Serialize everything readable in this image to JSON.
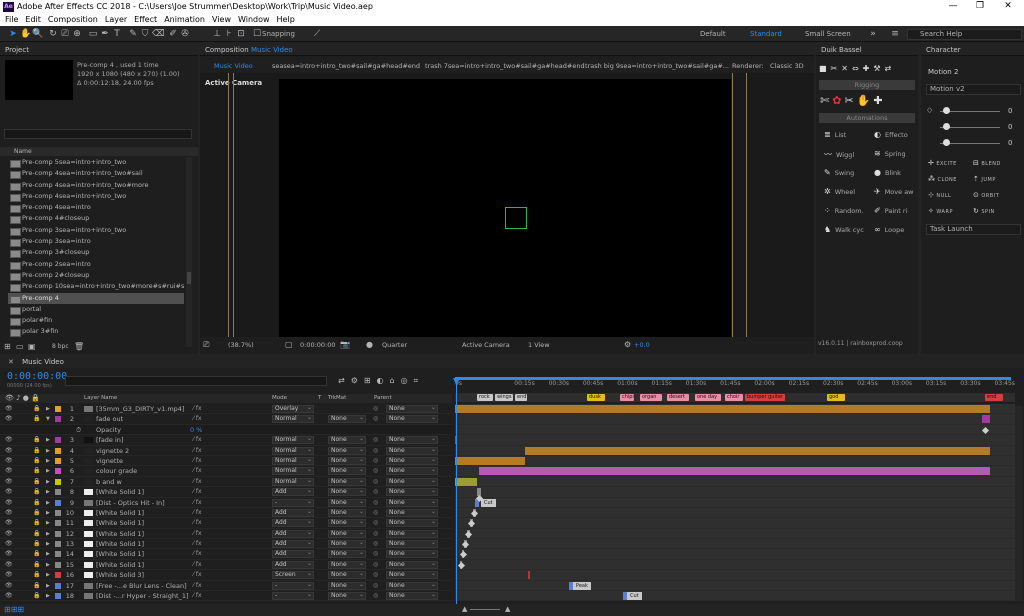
{
  "window": {
    "title": "Adobe After Effects CC 2018 - C:\\Users\\Joe Strummer\\Desktop\\Work\\Trip\\Music Video.aep",
    "logo": "Ae",
    "controls": [
      "—",
      "❐",
      "✕"
    ]
  },
  "menu": [
    "File",
    "Edit",
    "Composition",
    "Layer",
    "Effect",
    "Animation",
    "View",
    "Window",
    "Help"
  ],
  "toolbar": {
    "snapping": "Snapping",
    "workspaces": [
      "Default",
      "Standard",
      "Small Screen"
    ],
    "active_workspace": "Standard",
    "search_placeholder": "Search Help"
  },
  "project": {
    "title": "Project",
    "selected_name": "Pre-comp 4",
    "used": ", used 1 time",
    "dims": "1920 x 1080  (480 x 270) (1.00)",
    "duration": "Δ 0:00:12:18, 24.00 fps",
    "col_name": "Name",
    "items": [
      "Pre-comp 5sea=intro+intro_two",
      "Pre-comp 4sea=intro+intro_two#sail",
      "Pre-comp 4sea=intro+intro_two#more",
      "Pre-comp 4sea=intro+intro_two",
      "Pre-comp 4sea=intro",
      "Pre-comp 4#closeup",
      "Pre-comp 3sea=intro+intro_two",
      "Pre-comp 3sea=intro",
      "Pre-comp 3#closeup",
      "Pre-comp 2sea=intro",
      "Pre-comp 2#closeup",
      "Pre-comp 10sea=intro+intro_two#more#s#rui#slide#m",
      "Pre-comp 4",
      "portal",
      "polar#fin",
      "polar 3#fin"
    ],
    "selected_index": 12,
    "bpc": "8 bpc"
  },
  "composition": {
    "title": "Composition",
    "comp_name": "Music Video",
    "tabs": [
      "Music Video",
      "seasea=intro+intro_two#sail#ga#head#end",
      "trash 7sea=intro+intro_two#sail#ga#head#end",
      "trash big 9sea=intro+intro_two#sail#ga#..."
    ],
    "renderer_label": "Renderer:",
    "renderer": "Classic 3D",
    "camera_label": "Active Camera",
    "zoom": "(38.7%)",
    "timecode": "0:00:00:00",
    "resolution": "Quarter",
    "camera": "Active Camera",
    "view": "1 View",
    "exposure": "+0.0"
  },
  "duik": {
    "title": "Duik Bassel",
    "rigging": "Rigging",
    "automations": "Automations",
    "buttons": [
      {
        "label": "List",
        "icon": "≣"
      },
      {
        "label": "Effecto",
        "icon": "◐"
      },
      {
        "label": "Wiggl",
        "icon": "〰"
      },
      {
        "label": "Spring",
        "icon": "≋"
      },
      {
        "label": "Swing",
        "icon": "✎"
      },
      {
        "label": "Blink",
        "icon": "●"
      },
      {
        "label": "Wheel",
        "icon": "✲"
      },
      {
        "label": "Move aw",
        "icon": "✈"
      },
      {
        "label": "Random.",
        "icon": "⁘"
      },
      {
        "label": "Paint ri",
        "icon": "✐"
      },
      {
        "label": "Walk cyc",
        "icon": "♞"
      },
      {
        "label": "Loope",
        "icon": "∞"
      }
    ],
    "version": "v16.0.11 | rainboxprod.coop"
  },
  "character": {
    "title": "Character",
    "motion_title": "Motion 2",
    "preset": "Motion v2",
    "slider_values": [
      "0",
      "0",
      "0"
    ],
    "buttons": [
      {
        "label": "EXCITE",
        "icon": "✛"
      },
      {
        "label": "BLEND",
        "icon": "⊟"
      },
      {
        "label": "CLONE",
        "icon": "⁂"
      },
      {
        "label": "JUMP",
        "icon": "⇡"
      },
      {
        "label": "NULL",
        "icon": "⊹"
      },
      {
        "label": "ORBIT",
        "icon": "⊙"
      },
      {
        "label": "WARP",
        "icon": "✧"
      },
      {
        "label": "SPIN",
        "icon": "↻"
      }
    ],
    "task": "Task Launch"
  },
  "timeline": {
    "tab": "Music Video",
    "timecode": "0:00:00:00",
    "fps": "00000 (24.00 fps)",
    "headers": {
      "layer_name": "Layer Name",
      "mode": "Mode",
      "t": "T",
      "trkmat": "TrkMat",
      "parent": "Parent"
    },
    "ruler": [
      "0s",
      "00:15s",
      "00:30s",
      "00:45s",
      "01:00s",
      "01:15s",
      "01:30s",
      "01:45s",
      "02:00s",
      "02:15s",
      "02:30s",
      "02:45s",
      "03:00s",
      "03:15s",
      "03:30s",
      "03:45s",
      "04:0"
    ],
    "markers": [
      {
        "label": "rock",
        "color": "#c8c8c8"
      },
      {
        "label": "wings",
        "color": "#c8c8c8"
      },
      {
        "label": "end",
        "color": "#c8c8c8"
      },
      {
        "label": "dusk",
        "color": "#e0c020"
      },
      {
        "label": "chips",
        "color": "#e88fa8"
      },
      {
        "label": "organ",
        "color": "#e88fa8"
      },
      {
        "label": "desert",
        "color": "#e88fa8"
      },
      {
        "label": "one day",
        "color": "#e88fa8"
      },
      {
        "label": "choir",
        "color": "#e88fa8"
      },
      {
        "label": "bumper guitar",
        "color": "#d04040"
      },
      {
        "label": "god",
        "color": "#e0c020"
      },
      {
        "label": "end",
        "color": "#d04040"
      }
    ],
    "opacity_label": "Opacity",
    "opacity_value": "0 %",
    "cut_label": "Cut",
    "peak_label": "Peak",
    "layers": [
      {
        "num": "1",
        "name": "[35mm_G3_DIRTY_v1.mp4]",
        "label": "#e0a020",
        "thumb": "#777",
        "mode": "Overlay",
        "trk": "",
        "parent": "None"
      },
      {
        "num": "2",
        "name": "fade out",
        "label": "#a33aa3",
        "thumb": "#222",
        "mode": "Normal",
        "trk": "None",
        "parent": "None"
      },
      {
        "num": "3",
        "name": "[fade in]",
        "label": "#a33aa3",
        "thumb": "#111",
        "mode": "Normal",
        "trk": "None",
        "parent": "None"
      },
      {
        "num": "4",
        "name": "vignette 2",
        "label": "#e0a020",
        "thumb": "#222",
        "mode": "Normal",
        "trk": "None",
        "parent": "None"
      },
      {
        "num": "5",
        "name": "vignette",
        "label": "#e0a020",
        "thumb": "#222",
        "mode": "Normal",
        "trk": "None",
        "parent": "None"
      },
      {
        "num": "6",
        "name": "colour grade",
        "label": "#c64bc6",
        "thumb": "#222",
        "mode": "Normal",
        "trk": "None",
        "parent": "None"
      },
      {
        "num": "7",
        "name": "b and w",
        "label": "#c8c800",
        "thumb": "#222",
        "mode": "Normal",
        "trk": "None",
        "parent": "None"
      },
      {
        "num": "8",
        "name": "[White Solid 1]",
        "label": "#888",
        "thumb": "#eee",
        "mode": "Add",
        "trk": "None",
        "parent": "None"
      },
      {
        "num": "9",
        "name": "[Dist - Optics Hit - In]",
        "label": "#5b7fd0",
        "thumb": "#777",
        "mode": "-",
        "trk": "None",
        "parent": "None"
      },
      {
        "num": "10",
        "name": "[White Solid 1]",
        "label": "#888",
        "thumb": "#eee",
        "mode": "Add",
        "trk": "None",
        "parent": "None"
      },
      {
        "num": "11",
        "name": "[White Solid 1]",
        "label": "#888",
        "thumb": "#eee",
        "mode": "Add",
        "trk": "None",
        "parent": "None"
      },
      {
        "num": "12",
        "name": "[White Solid 1]",
        "label": "#888",
        "thumb": "#eee",
        "mode": "Add",
        "trk": "None",
        "parent": "None"
      },
      {
        "num": "13",
        "name": "[White Solid 1]",
        "label": "#888",
        "thumb": "#eee",
        "mode": "Add",
        "trk": "None",
        "parent": "None"
      },
      {
        "num": "14",
        "name": "[White Solid 1]",
        "label": "#888",
        "thumb": "#eee",
        "mode": "Add",
        "trk": "None",
        "parent": "None"
      },
      {
        "num": "15",
        "name": "[White Solid 1]",
        "label": "#888",
        "thumb": "#eee",
        "mode": "Add",
        "trk": "None",
        "parent": "None"
      },
      {
        "num": "16",
        "name": "[White Solid 3]",
        "label": "#d04040",
        "thumb": "#eee",
        "mode": "Screen",
        "trk": "None",
        "parent": "None"
      },
      {
        "num": "17",
        "name": "[Free -...e Blur Lens - Clean]",
        "label": "#5b7fd0",
        "thumb": "#777",
        "mode": "-",
        "trk": "None",
        "parent": "None"
      },
      {
        "num": "18",
        "name": "[Dist -...r Hyper - Straight_1]",
        "label": "#5b7fd0",
        "thumb": "#777",
        "mode": "-",
        "trk": "None",
        "parent": "None"
      }
    ]
  }
}
